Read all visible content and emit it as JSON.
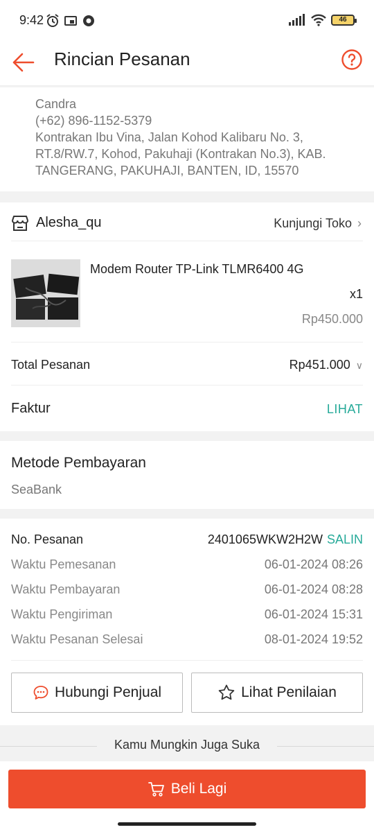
{
  "status_bar": {
    "time": "9:42",
    "battery": "46"
  },
  "header": {
    "title": "Rincian Pesanan"
  },
  "address": {
    "name": "Candra",
    "phone": "(+62) 896-1152-5379",
    "line1": "Kontrakan Ibu Vina, Jalan Kohod Kalibaru No. 3,",
    "line2": "RT.8/RW.7, Kohod, Pakuhaji (Kontrakan No.3), KAB.",
    "line3": "TANGERANG, PAKUHAJI, BANTEN, ID, 15570"
  },
  "shop": {
    "name": "Alesha_qu",
    "visit_label": "Kunjungi Toko",
    "product": {
      "name": "Modem Router TP-Link TLMR6400 4G",
      "qty": "x1",
      "price": "Rp450.000"
    },
    "total_label": "Total Pesanan",
    "total_value": "Rp451.000",
    "invoice_label": "Faktur",
    "invoice_link": "LIHAT"
  },
  "payment": {
    "title": "Metode Pembayaran",
    "method": "SeaBank"
  },
  "order": {
    "number_label": "No. Pesanan",
    "number_value": "2401065WKW2H2W",
    "copy_label": "SALIN",
    "rows": [
      {
        "label": "Waktu Pemesanan",
        "value": "06-01-2024 08:26"
      },
      {
        "label": "Waktu Pembayaran",
        "value": "06-01-2024 08:28"
      },
      {
        "label": "Waktu Pengiriman",
        "value": "06-01-2024 15:31"
      },
      {
        "label": "Waktu Pesanan Selesai",
        "value": "08-01-2024 19:52"
      }
    ]
  },
  "actions": {
    "contact_seller": "Hubungi Penjual",
    "view_rating": "Lihat Penilaian"
  },
  "suggestions": {
    "title": "Kamu Mungkin Juga Suka"
  },
  "bottom": {
    "buy_again": "Beli Lagi"
  },
  "colors": {
    "accent": "#ee4d2d",
    "link": "#26aa99"
  },
  "icons": [
    "back-arrow-icon",
    "help-icon",
    "store-icon",
    "chevron-right-icon",
    "chevron-down-icon",
    "chat-icon",
    "star-icon",
    "cart-icon"
  ]
}
